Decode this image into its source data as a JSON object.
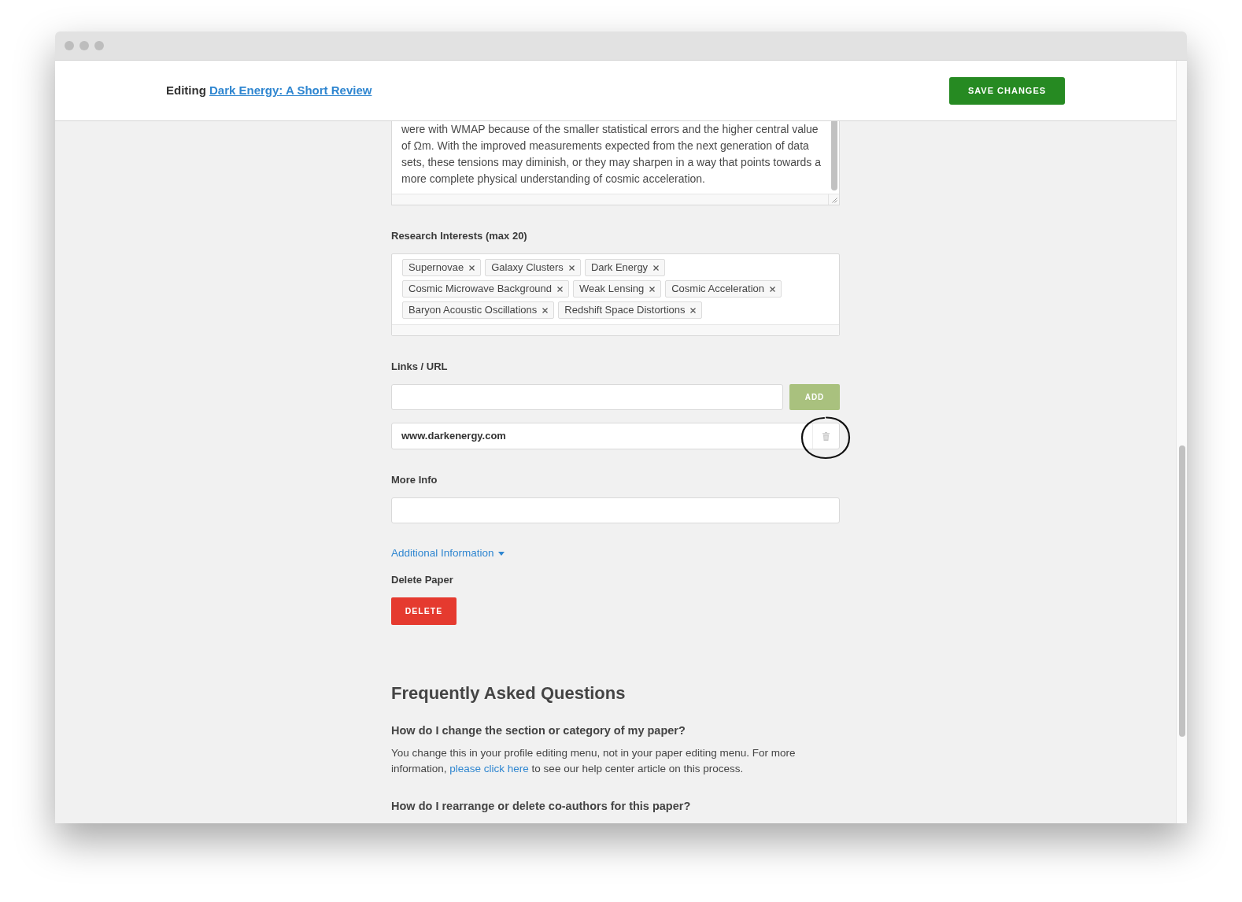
{
  "header": {
    "prefix": "Editing",
    "paper_title": "Dark Energy: A Short Review",
    "save_button": "SAVE CHANGES"
  },
  "abstract": {
    "text": "were with WMAP because of the smaller statistical errors and the higher central value of Ωm. With the improved measurements expected from the next generation of data sets, these tensions may diminish, or they may sharpen in a way that points towards a more complete physical understanding of cosmic acceleration."
  },
  "research_interests": {
    "label": "Research Interests (max 20)",
    "tags": [
      {
        "label": "Supernovae"
      },
      {
        "label": "Galaxy Clusters"
      },
      {
        "label": "Dark Energy"
      },
      {
        "label": "Cosmic Microwave Background"
      },
      {
        "label": "Weak Lensing"
      },
      {
        "label": "Cosmic Acceleration"
      },
      {
        "label": "Baryon Acoustic Oscillations"
      },
      {
        "label": "Redshift Space Distortions"
      }
    ]
  },
  "links": {
    "label": "Links / URL",
    "add_button": {
      "label": "ADD",
      "disabled": true
    },
    "items": [
      {
        "url": "www.darkenergy.com"
      }
    ]
  },
  "more_info": {
    "label": "More Info"
  },
  "additional_information": {
    "label": "Additional Information",
    "expanded": false
  },
  "delete_paper": {
    "label": "Delete Paper",
    "button": "DELETE"
  },
  "faq": {
    "title": "Frequently Asked Questions",
    "items": [
      {
        "question": "How do I change the section or category of my paper?",
        "answer": {
          "before": "You change this in your profile editing menu, not in your paper editing menu. For more information,",
          "link": "please click here",
          "after": "to see our help center article on this process."
        }
      },
      {
        "question": "How do I rearrange or delete co-authors for this paper?"
      }
    ]
  }
}
